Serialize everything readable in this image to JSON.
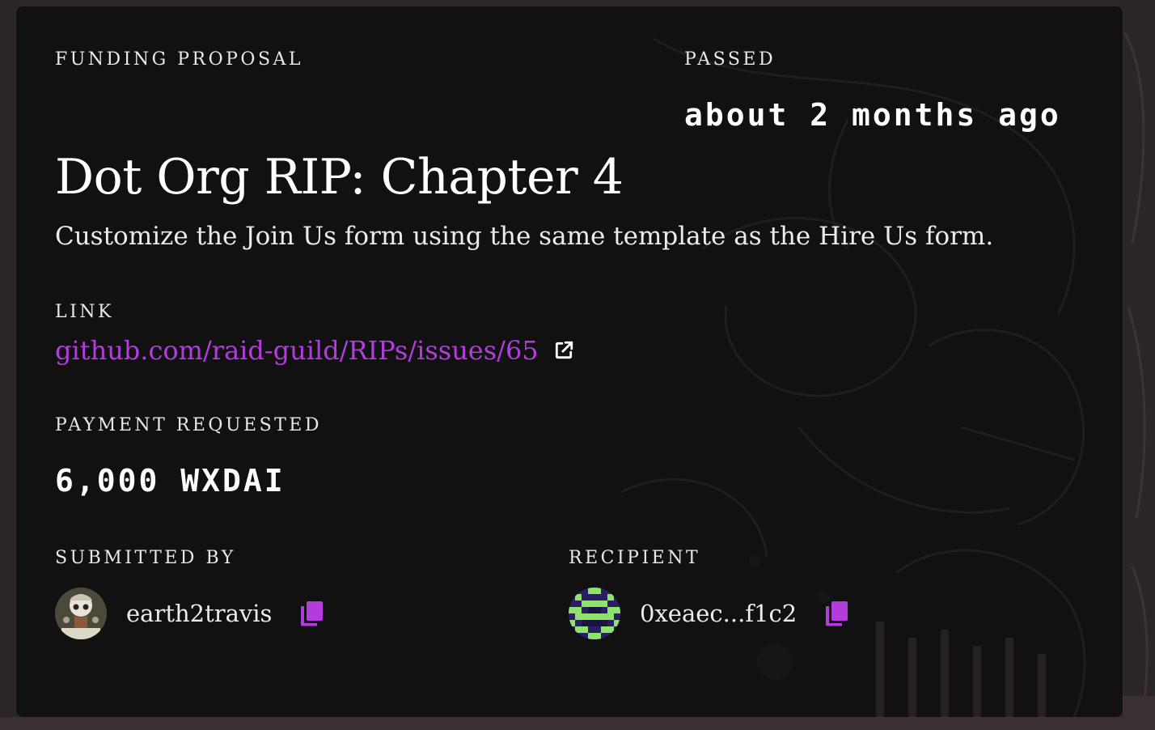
{
  "proposal": {
    "type_label": "FUNDING PROPOSAL",
    "status_label": "PASSED",
    "status_time": "about 2 months ago",
    "title": "Dot Org RIP: Chapter 4",
    "description": "Customize the Join Us form using the same template as the Hire Us form."
  },
  "link": {
    "label": "LINK",
    "text": "github.com/raid-guild/RIPs/issues/65",
    "icon": "external-link-icon"
  },
  "payment": {
    "label": "PAYMENT REQUESTED",
    "amount": "6,000 WXDAI"
  },
  "submitted_by": {
    "label": "SUBMITTED BY",
    "name": "earth2travis",
    "copy_icon": "copy-icon"
  },
  "recipient": {
    "label": "RECIPIENT",
    "address": "0xeaec...f1c2",
    "copy_icon": "copy-icon"
  },
  "colors": {
    "accent": "#b33cdc",
    "card_bg": "#111112",
    "page_bg": "#2a2527",
    "text": "#ffffff"
  }
}
